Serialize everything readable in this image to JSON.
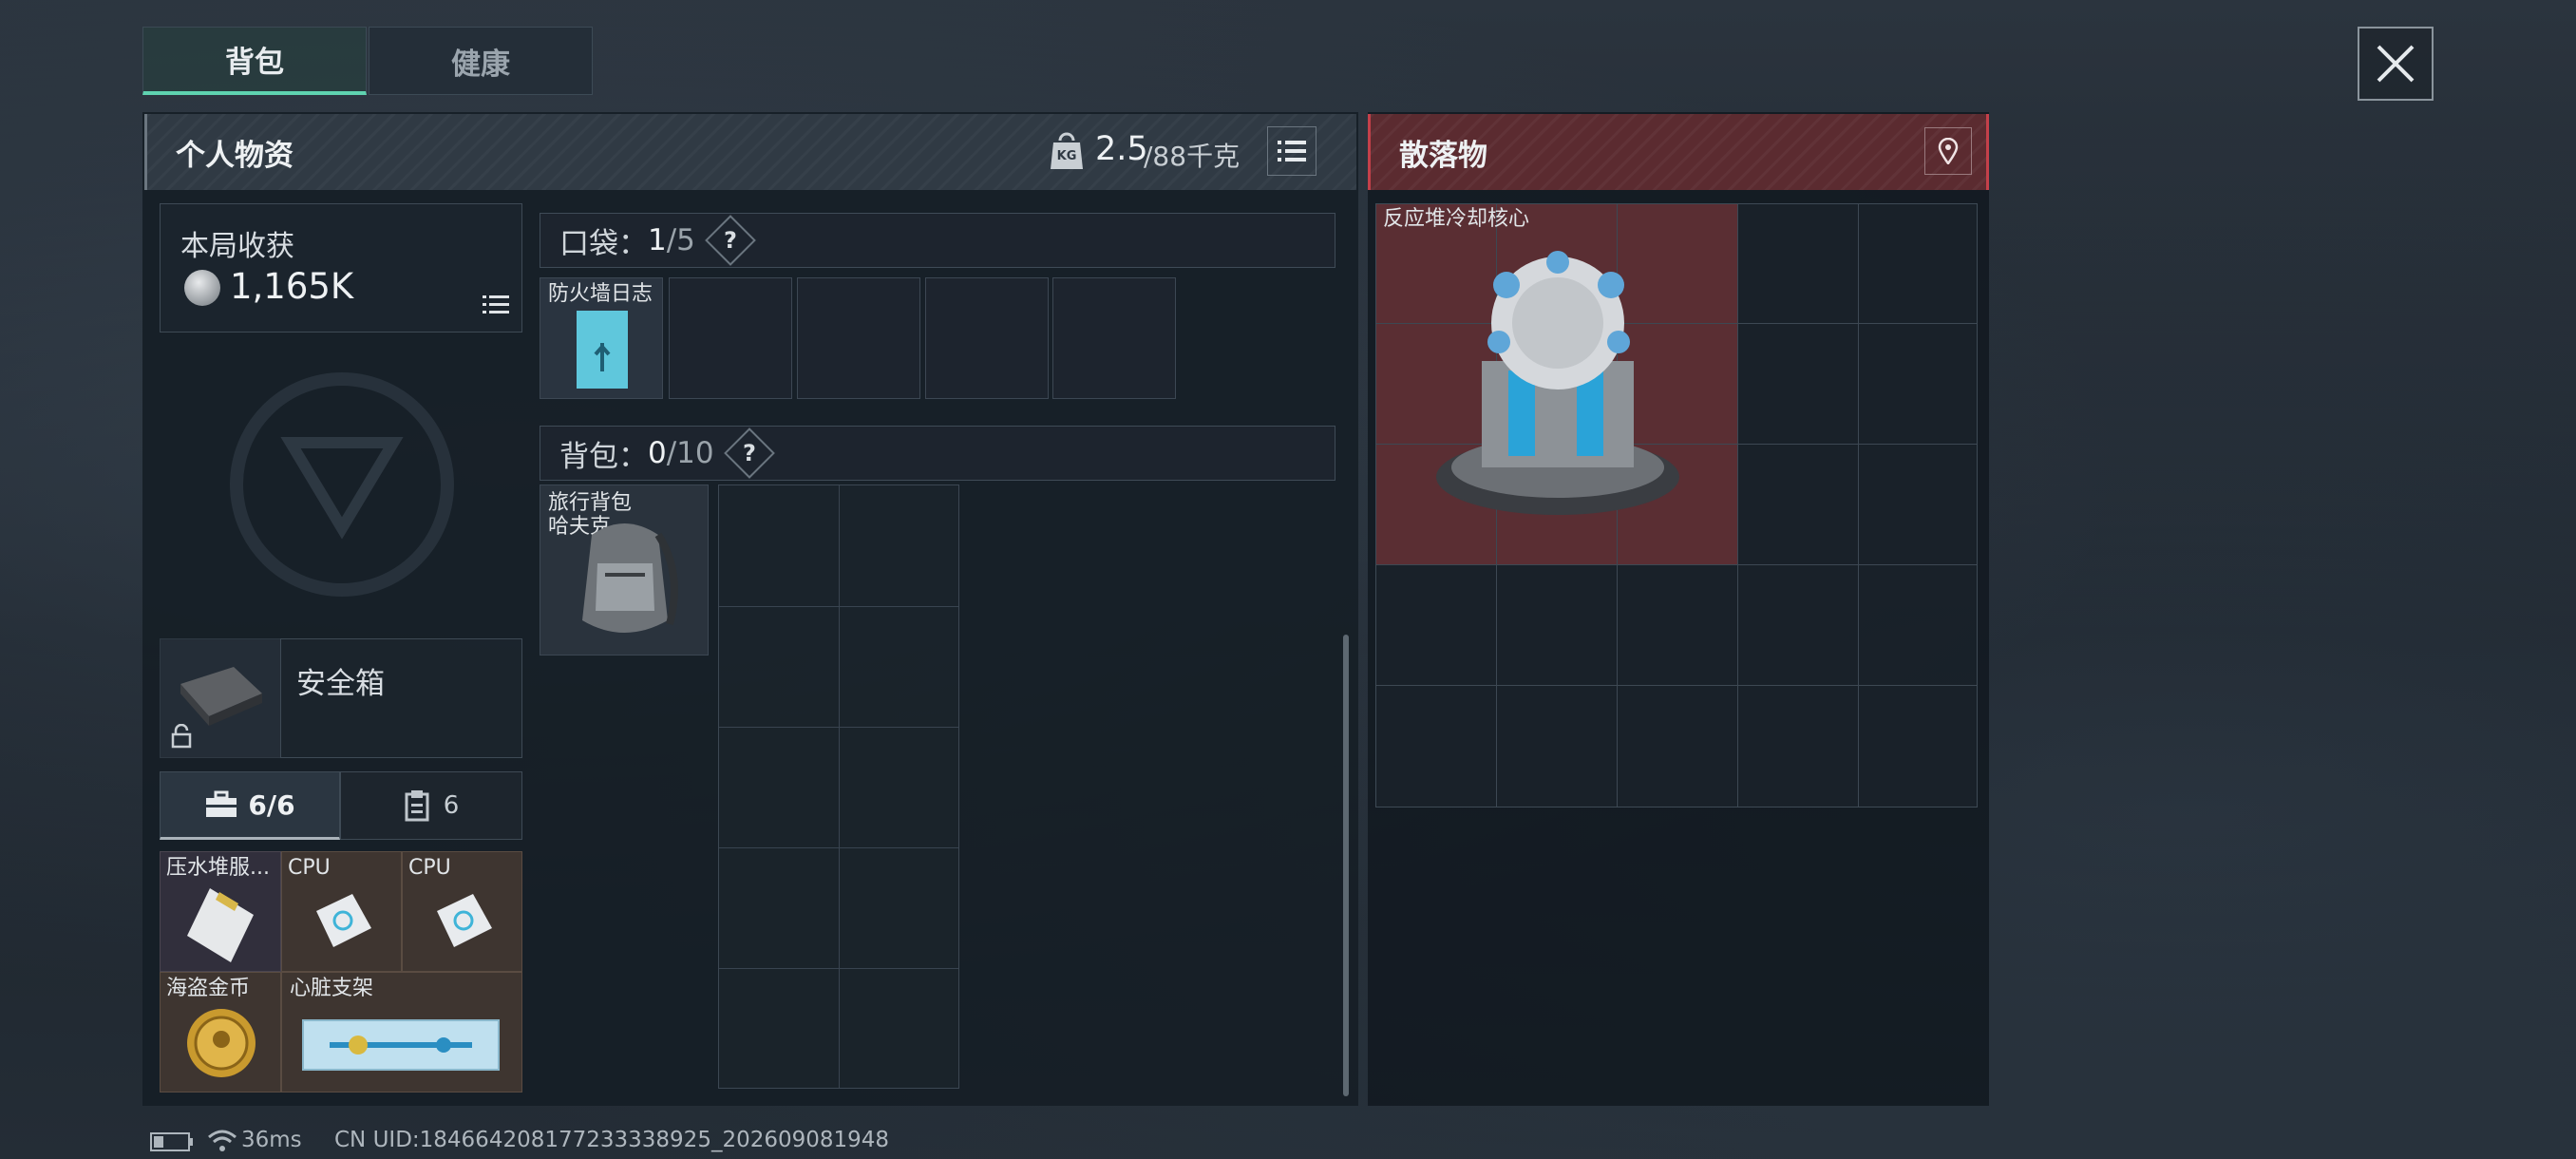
{
  "tabs": [
    {
      "label": "背包",
      "active": true
    },
    {
      "label": "健康",
      "active": false
    }
  ],
  "personal": {
    "title": "个人物资",
    "weight_current": "2.5",
    "weight_max": "/88千克",
    "weight_icon_text": "KG"
  },
  "loot": {
    "title": "散落物"
  },
  "earnings": {
    "label": "本局收获",
    "value": "1,165K"
  },
  "safebox": {
    "label": "安全箱"
  },
  "tool_tabs": [
    {
      "label": "6/6",
      "icon": "toolbox-icon"
    },
    {
      "label": "6",
      "icon": "clipboard-icon"
    }
  ],
  "safe_items": [
    {
      "name": "压水堆服..."
    },
    {
      "name": "CPU"
    },
    {
      "name": "CPU"
    },
    {
      "name": "海盗金币"
    },
    {
      "name": "心脏支架"
    }
  ],
  "pocket": {
    "label": "口袋：",
    "count": "1",
    "capacity": "/5",
    "item": "防火墙日志",
    "help": "?"
  },
  "backpack": {
    "label": "背包：",
    "count": "0",
    "capacity": "/10",
    "item_line1": "旅行背包",
    "item_line2": "哈夫克",
    "help": "?"
  },
  "loot_item": {
    "name": "反应堆冷却核心"
  },
  "status": {
    "ping": "36ms",
    "uid": "CN UID:184664208177233338925_202609081948"
  },
  "colors": {
    "accent": "#5fd3b0",
    "loot_red": "#c4404a"
  }
}
